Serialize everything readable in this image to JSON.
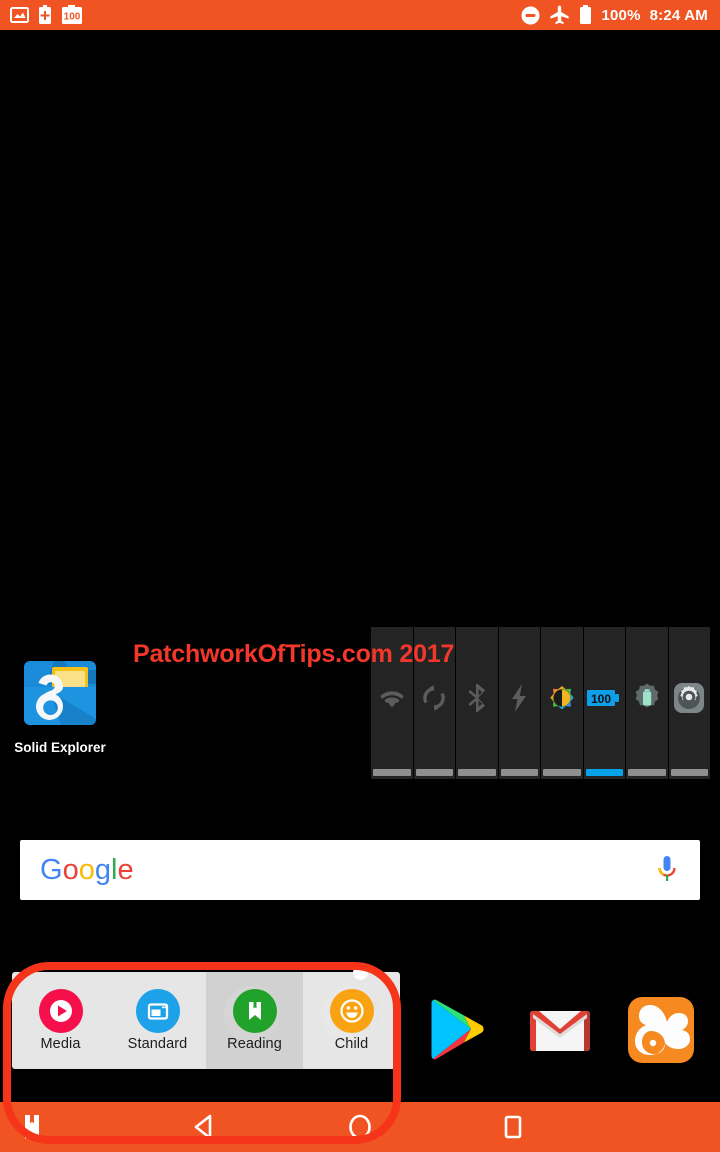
{
  "status_bar": {
    "background_color": "#F05423",
    "left_icons": [
      {
        "name": "screenshot-icon",
        "label": "Screenshot"
      },
      {
        "name": "battery-plus-icon",
        "label": "Battery Saver"
      },
      {
        "name": "battery-100-badge-icon",
        "label": "100"
      }
    ],
    "right_icons": [
      {
        "name": "do-not-disturb-icon",
        "label": "Do Not Disturb"
      },
      {
        "name": "airplane-mode-icon",
        "label": "Airplane Mode"
      },
      {
        "name": "battery-icon",
        "label": "Battery Full"
      }
    ],
    "battery_percent": "100%",
    "clock": "8:24 AM"
  },
  "watermark": {
    "text": "PatchworkOfTips.com 2017",
    "color": "#F4372B"
  },
  "home_screen": {
    "apps": [
      {
        "name": "solid-explorer",
        "label": "Solid Explorer"
      }
    ]
  },
  "toggle_widget": {
    "cells": [
      {
        "name": "wifi-toggle",
        "label": "Wi-Fi",
        "active": false
      },
      {
        "name": "sync-toggle",
        "label": "Sync",
        "active": false
      },
      {
        "name": "bluetooth-toggle",
        "label": "Bluetooth",
        "active": false
      },
      {
        "name": "flash-toggle",
        "label": "Flashlight",
        "active": false
      },
      {
        "name": "brightness-toggle",
        "label": "Brightness",
        "active": false
      },
      {
        "name": "battery-percent-toggle",
        "label": "100",
        "active": true
      },
      {
        "name": "battery-settings-toggle",
        "label": "Battery Settings",
        "active": false
      },
      {
        "name": "settings-toggle",
        "label": "Settings",
        "active": false
      }
    ],
    "active_color": "#06A3E8",
    "inactive_color": "#8f8f8f"
  },
  "search": {
    "logo_text": "Google",
    "logo_letters": [
      {
        "char": "G",
        "color": "#4285F4"
      },
      {
        "char": "o",
        "color": "#EA4335"
      },
      {
        "char": "o",
        "color": "#FBBC05"
      },
      {
        "char": "g",
        "color": "#4285F4"
      },
      {
        "char": "l",
        "color": "#34A853"
      },
      {
        "char": "e",
        "color": "#EA4335"
      }
    ],
    "mic_icon": "voice-search-icon"
  },
  "mode_switcher": {
    "modes": [
      {
        "name": "mode-media",
        "label": "Media",
        "color": "#F50F4B",
        "selected": false
      },
      {
        "name": "mode-standard",
        "label": "Standard",
        "color": "#1DA1E8",
        "selected": false
      },
      {
        "name": "mode-reading",
        "label": "Reading",
        "color": "#21A22B",
        "selected": true
      },
      {
        "name": "mode-child",
        "label": "Child",
        "color": "#F9A313",
        "selected": false
      }
    ]
  },
  "dock": {
    "apps": [
      {
        "name": "play-store",
        "label": "Play Store"
      },
      {
        "name": "gmail",
        "label": "Gmail"
      },
      {
        "name": "uc-browser",
        "label": "UC Browser"
      }
    ]
  },
  "nav_bar": {
    "background_color": "#F05423",
    "buttons": [
      {
        "name": "nav-reading-mode",
        "label": "Reading Mode"
      },
      {
        "name": "nav-back",
        "label": "Back"
      },
      {
        "name": "nav-home",
        "label": "Home"
      },
      {
        "name": "nav-recents",
        "label": "Recent Apps"
      }
    ]
  },
  "annotation": {
    "highlight_color": "#F5341A",
    "label": "Highlighted region"
  }
}
